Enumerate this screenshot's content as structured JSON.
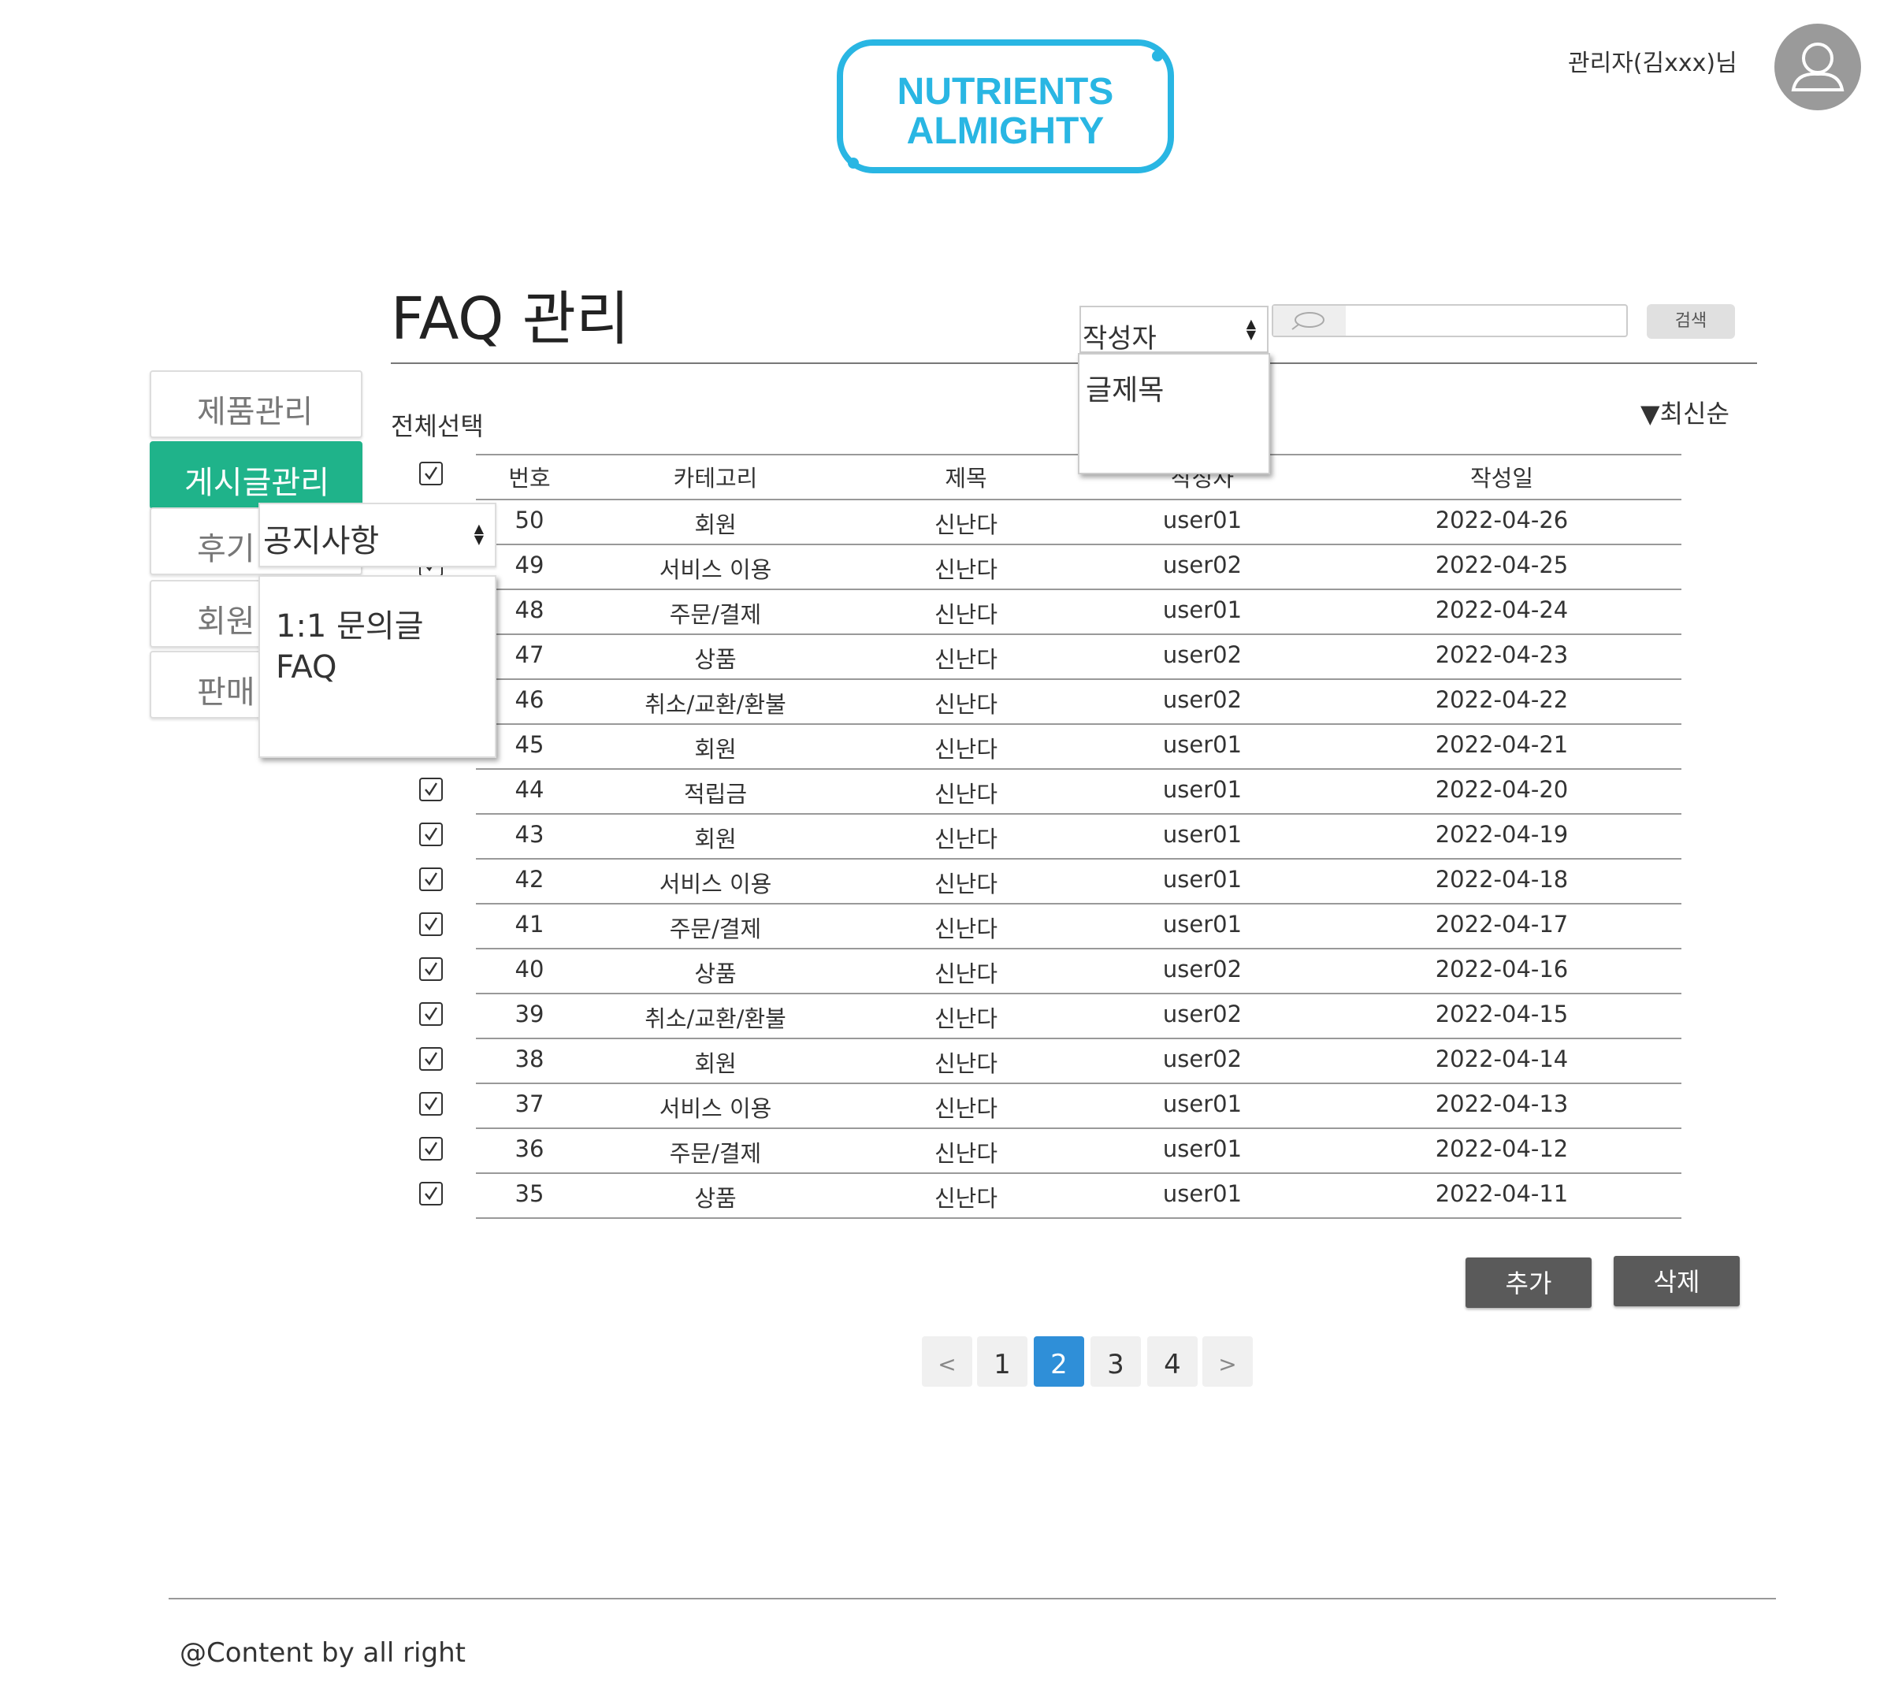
{
  "header": {
    "logo_line1": "NUTRIENTS",
    "logo_line2": "ALMIGHTY",
    "admin_name": "관리자(김xxx)님"
  },
  "page": {
    "title": "FAQ 관리"
  },
  "search": {
    "select_value": "작성자",
    "dropdown_options": [
      "글제목"
    ],
    "input_value": "",
    "button_label": "검색"
  },
  "sort": {
    "label": "▼최신순"
  },
  "sidebar": {
    "items": [
      {
        "label": "제품관리"
      },
      {
        "label": "게시글관리"
      },
      {
        "label": "후기"
      },
      {
        "label": "회원"
      },
      {
        "label": "판매"
      }
    ],
    "board_select": {
      "value": "공지사항",
      "options": [
        "1:1 문의글",
        "FAQ"
      ]
    }
  },
  "table": {
    "select_all_label": "전체선택",
    "columns": [
      "번호",
      "카테고리",
      "제목",
      "작성자",
      "작성일"
    ],
    "rows": [
      [
        "50",
        "회원",
        "신난다",
        "user01",
        "2022-04-26"
      ],
      [
        "49",
        "서비스 이용",
        "신난다",
        "user02",
        "2022-04-25"
      ],
      [
        "48",
        "주문/결제",
        "신난다",
        "user01",
        "2022-04-24"
      ],
      [
        "47",
        "상품",
        "신난다",
        "user02",
        "2022-04-23"
      ],
      [
        "46",
        "취소/교환/환불",
        "신난다",
        "user02",
        "2022-04-22"
      ],
      [
        "45",
        "회원",
        "신난다",
        "user01",
        "2022-04-21"
      ],
      [
        "44",
        "적립금",
        "신난다",
        "user01",
        "2022-04-20"
      ],
      [
        "43",
        "회원",
        "신난다",
        "user01",
        "2022-04-19"
      ],
      [
        "42",
        "서비스 이용",
        "신난다",
        "user01",
        "2022-04-18"
      ],
      [
        "41",
        "주문/결제",
        "신난다",
        "user01",
        "2022-04-17"
      ],
      [
        "40",
        "상품",
        "신난다",
        "user02",
        "2022-04-16"
      ],
      [
        "39",
        "취소/교환/환불",
        "신난다",
        "user02",
        "2022-04-15"
      ],
      [
        "38",
        "회원",
        "신난다",
        "user02",
        "2022-04-14"
      ],
      [
        "37",
        "서비스 이용",
        "신난다",
        "user01",
        "2022-04-13"
      ],
      [
        "36",
        "주문/결제",
        "신난다",
        "user01",
        "2022-04-12"
      ],
      [
        "35",
        "상품",
        "신난다",
        "user01",
        "2022-04-11"
      ]
    ]
  },
  "actions": {
    "add_label": "추가",
    "delete_label": "삭제"
  },
  "pagination": {
    "prev": "<",
    "pages": [
      "1",
      "2",
      "3",
      "4"
    ],
    "current": "2",
    "next": ">"
  },
  "footer": {
    "text": "@Content by all right"
  },
  "colors": {
    "brand": "#29b6e3",
    "sidebar_active": "#1fb38a",
    "page_active": "#2f8fd8",
    "button_dark": "#5a5a5a"
  }
}
